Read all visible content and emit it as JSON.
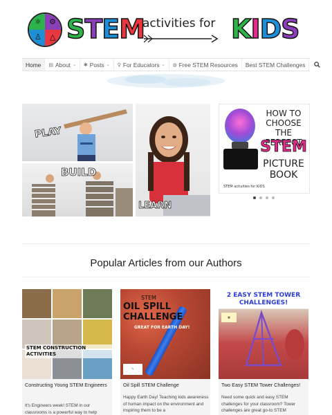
{
  "logo": {
    "word_stem": "STEM",
    "word_mid": "activities for",
    "word_kids": "KIDS",
    "colors": {
      "green": "#2db34a",
      "purple": "#8a3fb8",
      "blue": "#1e8fd6",
      "red": "#e8373e",
      "pink": "#e62a8c"
    }
  },
  "nav": {
    "items": [
      {
        "label": "Home",
        "icon": "",
        "dropdown": false,
        "active": true
      },
      {
        "label": "About",
        "icon": "info-icon",
        "dropdown": true,
        "active": false
      },
      {
        "label": "Posts",
        "icon": "gear-icon",
        "dropdown": true,
        "active": false
      },
      {
        "label": "For Educators",
        "icon": "lightbulb-icon",
        "dropdown": true,
        "active": false
      },
      {
        "label": "Free STEM Resources",
        "icon": "globe-icon",
        "dropdown": false,
        "active": false
      },
      {
        "label": "Best STEM Challenges",
        "icon": "",
        "dropdown": false,
        "active": false
      }
    ],
    "search_icon": "search-icon"
  },
  "hero": {
    "play_word": "PLAY",
    "build_word": "BUILD",
    "learn_word": "LEARN",
    "slide": {
      "line1": "HOW TO CHOOSE THE PERFECT",
      "line2": "STEM",
      "line3": "PICTURE BOOK"
    },
    "slide_count": 4,
    "active_slide": 1
  },
  "popular": {
    "heading": "Popular Articles from our Authors",
    "cards": [
      {
        "thumb_label": "STEM CONSTRUCTION ACTIVITIES",
        "title": "Constructing Young STEM Engineers",
        "excerpt": "It's Engineers week! STEM in our classrooms is a powerful way to help"
      },
      {
        "thumb_stem": "STEM",
        "thumb_title": "OIL SPILL CHALLENGE",
        "thumb_sub": "GREAT FOR EARTH DAY!",
        "title": "Oil Spill STEM Challenge",
        "excerpt": "Happy Earth Day! Teaching kids awareness of human impact on the environment and inspiring them to be a"
      },
      {
        "thumb_title": "2 EASY STEM TOWER CHALLENGES!",
        "title": "Two Easy STEM Tower Challenges!",
        "excerpt": "Need some quick and easy STEM challenges for your classroom? Tower challenges are great go-to STEM"
      }
    ]
  }
}
